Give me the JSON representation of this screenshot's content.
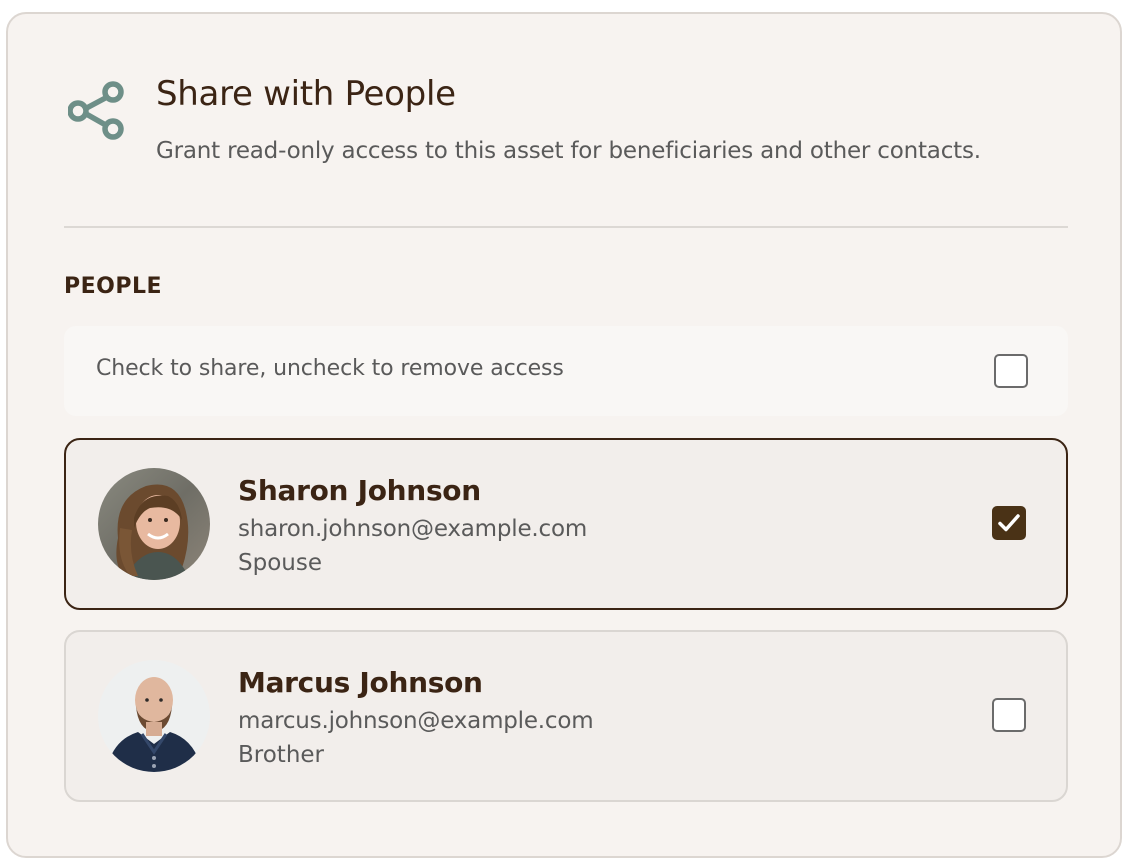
{
  "header": {
    "icon": "share-icon",
    "title": "Share with People",
    "subtitle": "Grant read-only access to this asset for beneficiaries and other contacts."
  },
  "section": {
    "label": "PEOPLE"
  },
  "select_all": {
    "label": "Check to share, uncheck to remove access",
    "checked": false
  },
  "people": [
    {
      "name": "Sharon Johnson",
      "email": "sharon.johnson@example.com",
      "relationship": "Spouse",
      "checked": true
    },
    {
      "name": "Marcus Johnson",
      "email": "marcus.johnson@example.com",
      "relationship": "Brother",
      "checked": false
    }
  ],
  "colors": {
    "accent": "#4a3216",
    "icon": "#6e8f88",
    "title": "#3b2414",
    "background": "#f7f3f0"
  }
}
